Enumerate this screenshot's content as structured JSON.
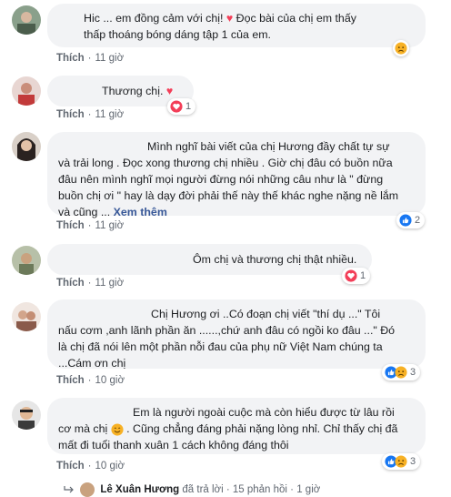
{
  "action_like": "Thích",
  "comments": [
    {
      "lines": [
        "Hic ... em đồng cảm với chị! ",
        "thấp thoáng bóng dáng tập 1 của em."
      ],
      "line1_heart": true,
      "line1_tail": " Đọc bài của chị em thấy",
      "time": "11 giờ",
      "reaction_count": ""
    },
    {
      "lines": [
        "Thương chị. "
      ],
      "time": "11 giờ",
      "reaction_count": "1"
    },
    {
      "lines": [
        "Mình nghĩ bài viết của chị Hương đầy chất tự sự",
        "và trải long . Đọc xong thương chị nhiều . Giờ chị đâu có buồn nữa",
        "đâu nên mình nghĩ mọi người đừng nói những câu như là \" đừng",
        "buồn chị ơi \" hay là dạy đời phải thế này thế khác nghe nặng nề lắm",
        "và cũng ... "
      ],
      "see_more": "Xem thêm",
      "time": "11 giờ",
      "reaction_count": "2"
    },
    {
      "lines": [
        "Ôm chị và thương chị thật nhiều."
      ],
      "time": "11 giờ",
      "reaction_count": "1"
    },
    {
      "lines": [
        "Chị Hương ơi ..Có đoạn chị viết \"thí dụ ...\" Tôi",
        "nấu cơm ,anh lãnh phần ăn ......,chứ anh đâu có ngồi ko đâu ...\" Đó",
        "là chị đã nói lên một phần nỗi đau của phụ nữ Việt Nam chúng ta",
        "...Cám ơn chị"
      ],
      "time": "10 giờ",
      "reaction_count": "3"
    },
    {
      "lines": [
        "Em là người ngoài cuộc mà còn hiểu được từ lâu rồi",
        "cơ mà chị ",
        "mất đi tuổi thanh xuân 1 cách không đáng thôi"
      ],
      "line2_tail": " . Cũng chẳng đáng phải nặng lòng nhỉ. Chỉ thấy chị đã",
      "time": "10 giờ",
      "reaction_count": "3"
    }
  ],
  "reply_bar": {
    "name": "Lê Xuân Hương",
    "text": " đã trả lời · 15 phản hồi · 1 giờ"
  },
  "colors": {
    "heart": "#f33e58",
    "like": "#1877f2",
    "sad": "#f7b125",
    "bubble": "#f2f3f5"
  }
}
